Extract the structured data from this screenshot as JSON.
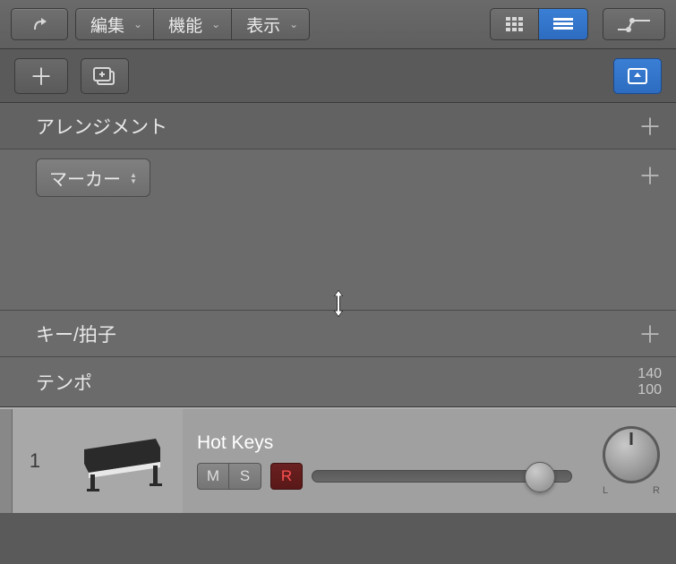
{
  "toolbar": {
    "menus": [
      {
        "label": "編集"
      },
      {
        "label": "機能"
      },
      {
        "label": "表示"
      }
    ]
  },
  "global_tracks": {
    "arrangement": {
      "label": "アレンジメント"
    },
    "marker": {
      "label": "マーカー"
    },
    "key_time": {
      "label": "キー/拍子"
    },
    "tempo": {
      "label": "テンポ",
      "high": "140",
      "low": "100"
    }
  },
  "track": {
    "number": "1",
    "name": "Hot Keys",
    "mute": "M",
    "solo": "S",
    "record": "R",
    "pan_l": "L",
    "pan_r": "R"
  }
}
